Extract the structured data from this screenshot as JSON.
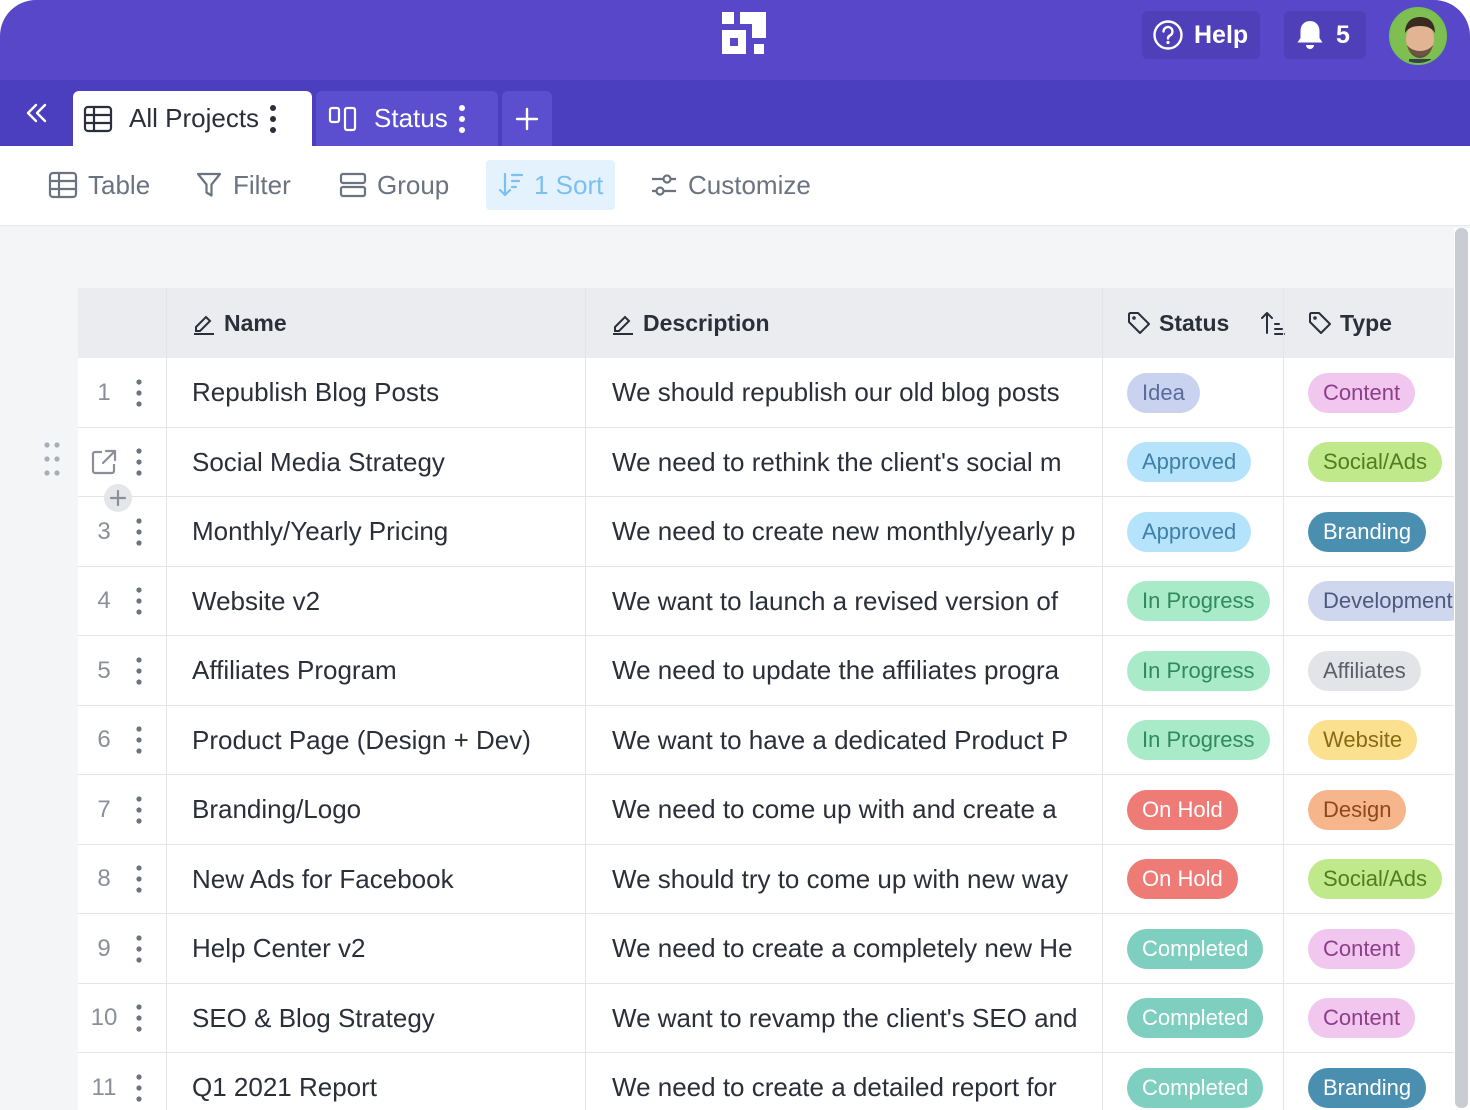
{
  "topbar": {
    "help_label": "Help",
    "notification_count": "5"
  },
  "tabs": {
    "items": [
      {
        "label": "All Projects",
        "icon": "table-icon"
      },
      {
        "label": "Status",
        "icon": "kanban-icon"
      }
    ],
    "add_icon": "plus-icon"
  },
  "toolbar": {
    "table_label": "Table",
    "filter_label": "Filter",
    "group_label": "Group",
    "sort_label": "1 Sort",
    "customize_label": "Customize"
  },
  "table": {
    "columns": {
      "name": "Name",
      "description": "Description",
      "status": "Status",
      "type": "Type"
    },
    "rows": [
      {
        "num": "1",
        "name": "Republish Blog Posts",
        "description": "We should republish our old blog posts",
        "status": "Idea",
        "type": "Content"
      },
      {
        "num": "",
        "name": "Social Media Strategy",
        "description": "We need to rethink the client's social m",
        "status": "Approved",
        "type": "Social/Ads"
      },
      {
        "num": "3",
        "name": "Monthly/Yearly Pricing",
        "description": "We need to create new monthly/yearly p",
        "status": "Approved",
        "type": "Branding"
      },
      {
        "num": "4",
        "name": "Website v2",
        "description": "We want to launch a revised version of",
        "status": "In Progress",
        "type": "Development"
      },
      {
        "num": "5",
        "name": "Affiliates Program",
        "description": "We need to update the affiliates progra",
        "status": "In Progress",
        "type": "Affiliates"
      },
      {
        "num": "6",
        "name": "Product Page (Design + Dev)",
        "description": "We want to have a dedicated Product P",
        "status": "In Progress",
        "type": "Website"
      },
      {
        "num": "7",
        "name": "Branding/Logo",
        "description": "We need to come up with and create a",
        "status": "On Hold",
        "type": "Design"
      },
      {
        "num": "8",
        "name": "New Ads for Facebook",
        "description": "We should try to come up with new way",
        "status": "On Hold",
        "type": "Social/Ads"
      },
      {
        "num": "9",
        "name": "Help Center v2",
        "description": "We need to create a completely new He",
        "status": "Completed",
        "type": "Content"
      },
      {
        "num": "10",
        "name": "SEO & Blog Strategy",
        "description": "We want to revamp the client's SEO and",
        "status": "Completed",
        "type": "Content"
      },
      {
        "num": "11",
        "name": "Q1 2021 Report",
        "description": "We need to create a detailed report for",
        "status": "Completed",
        "type": "Branding"
      }
    ]
  },
  "colors": {
    "topbar": "#5847c9",
    "tabbar": "#4c3fbf",
    "status": {
      "Idea": {
        "bg": "#c9d3f0",
        "fg": "#5a6a9c"
      },
      "Approved": {
        "bg": "#b5e3fb",
        "fg": "#3f7fa8"
      },
      "In Progress": {
        "bg": "#a9ebc8",
        "fg": "#2f8a5c"
      },
      "On Hold": {
        "bg": "#ee7b76",
        "fg": "#ffffff"
      },
      "Completed": {
        "bg": "#7fcfc1",
        "fg": "#ffffff"
      }
    },
    "type": {
      "Content": {
        "bg": "#f1c6ef",
        "fg": "#8c3f88"
      },
      "Social/Ads": {
        "bg": "#bfe98a",
        "fg": "#4f7d1f"
      },
      "Branding": {
        "bg": "#4b8fb0",
        "fg": "#ffffff"
      },
      "Development": {
        "bg": "#cfd7ee",
        "fg": "#4e5a7d"
      },
      "Affiliates": {
        "bg": "#e3e4e7",
        "fg": "#5a5f69"
      },
      "Website": {
        "bg": "#fbe08f",
        "fg": "#8a6a12"
      },
      "Design": {
        "bg": "#f6b58a",
        "fg": "#8c4a1c"
      }
    }
  }
}
